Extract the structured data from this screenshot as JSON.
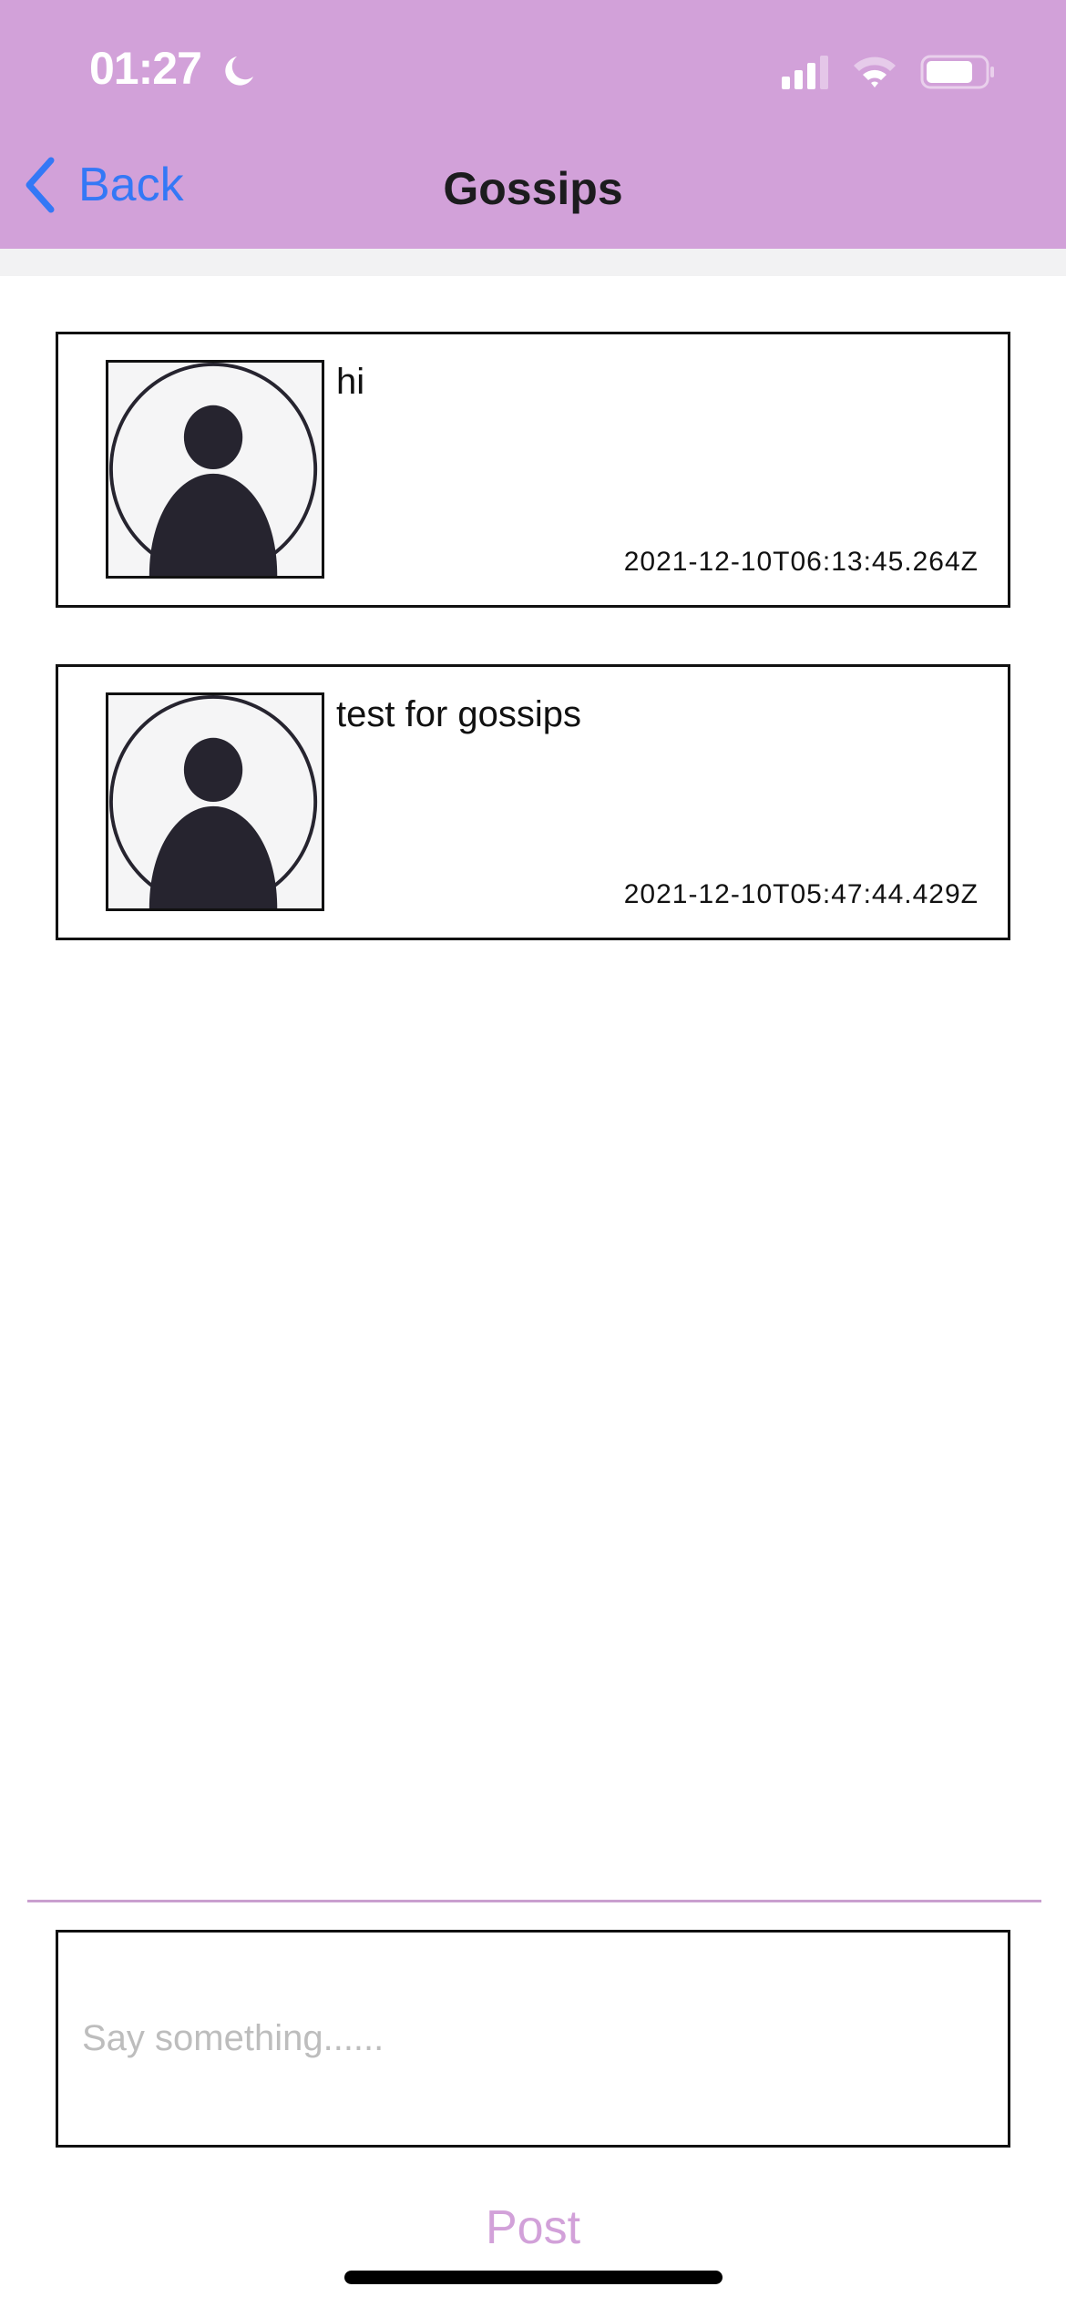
{
  "status_bar": {
    "time": "01:27"
  },
  "nav": {
    "back_label": "Back",
    "title": "Gossips"
  },
  "posts": [
    {
      "message": "hi",
      "timestamp": "2021-12-10T06:13:45.264Z"
    },
    {
      "message": "test for gossips",
      "timestamp": "2021-12-10T05:47:44.429Z"
    }
  ],
  "composer": {
    "placeholder": "Say something......",
    "post_label": "Post"
  },
  "colors": {
    "accent": "#d2a1d9",
    "link": "#3478f6"
  }
}
